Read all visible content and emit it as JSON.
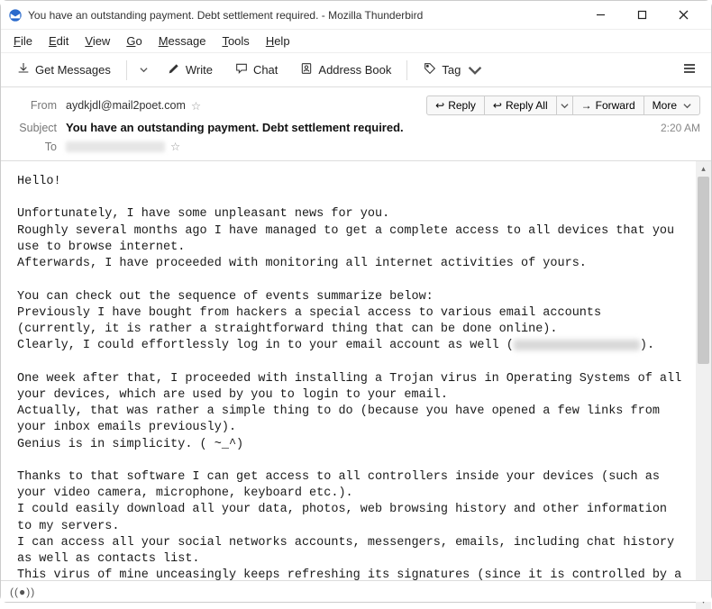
{
  "window": {
    "title": "You have an outstanding payment. Debt settlement required. - Mozilla Thunderbird"
  },
  "menubar": {
    "file": "File",
    "edit": "Edit",
    "view": "View",
    "go": "Go",
    "message": "Message",
    "tools": "Tools",
    "help": "Help"
  },
  "toolbar": {
    "get_messages": "Get Messages",
    "write": "Write",
    "chat": "Chat",
    "address_book": "Address Book",
    "tag": "Tag"
  },
  "headers": {
    "from_label": "From",
    "from_value": "aydkjdl@mail2poet.com",
    "subject_label": "Subject",
    "subject_value": "You have an outstanding payment. Debt settlement required.",
    "to_label": "To",
    "time": "2:20 AM"
  },
  "actions": {
    "reply": "Reply",
    "reply_all": "Reply All",
    "forward": "Forward",
    "more": "More"
  },
  "body_lines": [
    "Hello!",
    "",
    "Unfortunately, I have some unpleasant news for you.",
    "Roughly several months ago I have managed to get a complete access to all devices that you use to browse internet.",
    "Afterwards, I have proceeded with monitoring all internet activities of yours.",
    "",
    "You can check out the sequence of events summarize below:",
    "Previously I have bought from hackers a special access to various email accounts (currently, it is rather a straightforward thing that can be done online).",
    "Clearly, I could effortlessly log in to your email account as well ([REDACTED]).",
    "",
    "One week after that, I proceeded with installing a Trojan virus in Operating Systems of all your devices, which are used by you to login to your email.",
    "Actually, that was rather a simple thing to do (because you have opened a few links from your inbox emails previously).",
    "Genius is in simplicity. ( ~_^)",
    "",
    "Thanks to that software I can get access to all controllers inside your devices (such as your video camera, microphone, keyboard etc.).",
    "I could easily download all your data, photos, web browsing history and other information to my servers.",
    "I can access all your social networks accounts, messengers, emails, including chat history as well as contacts list.",
    "This virus of mine unceasingly keeps refreshing its signatures (since it is controlled by a driver), and as result stays unnoticed by antivirus software."
  ]
}
